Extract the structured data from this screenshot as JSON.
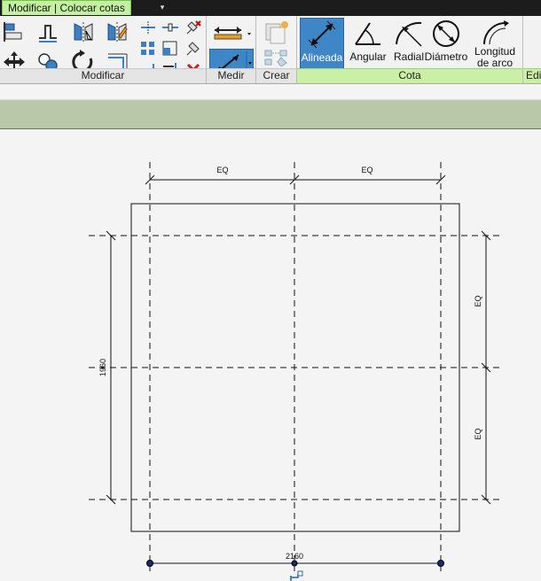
{
  "window": {
    "tab_title": "Modificar | Colocar cotas",
    "qat_symbol": "▾"
  },
  "ribbon": {
    "groups": {
      "modificar": "Modificar",
      "medir": "Medir",
      "crear": "Crear",
      "cota": "Cota",
      "edit_partial": "Edi"
    },
    "cota_tools": {
      "alineada": "Alineada",
      "angular": "Angular",
      "radial": "Radial",
      "diametro": "Diámetro",
      "longitud_line1": "Longitud",
      "longitud_line2": "de arco"
    }
  },
  "drawing": {
    "dimensions": {
      "top_left_label": "EQ",
      "top_right_label": "EQ",
      "right_top_label": "EQ",
      "right_bottom_label": "EQ",
      "left_total": "1960",
      "bottom_total": "2160"
    }
  },
  "colors": {
    "accent_blue": "#3f86c7",
    "green_tab": "#c4f0a2",
    "options_bar": "#b9c8a8"
  }
}
